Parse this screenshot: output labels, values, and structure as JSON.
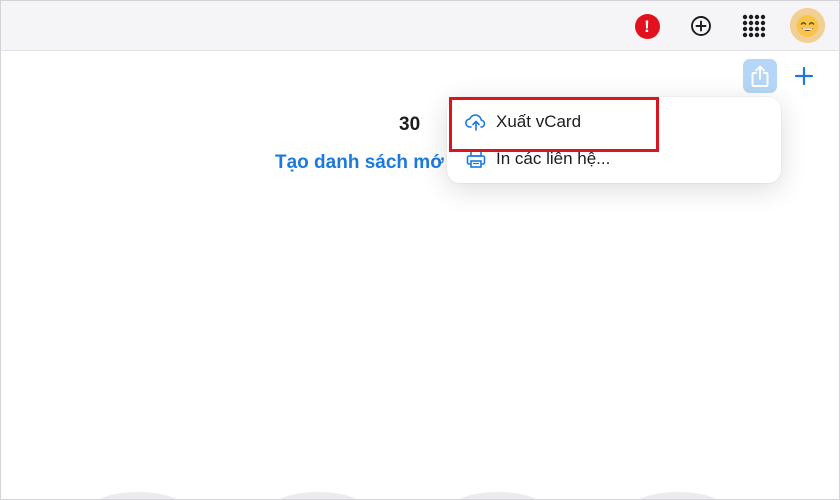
{
  "topbar": {
    "alert_symbol": "!",
    "icons": [
      "alert-icon",
      "add-circle-icon",
      "apps-grid-icon",
      "avatar-emoji"
    ]
  },
  "toolbar": {
    "icons": [
      "share-icon",
      "plus-icon"
    ]
  },
  "main": {
    "count": "30",
    "create_list_link": "Tạo danh sách mớ"
  },
  "dropdown": {
    "items": [
      {
        "icon": "cloud-upload-icon",
        "label": "Xuất vCard"
      },
      {
        "icon": "printer-icon",
        "label": "In các liên hệ..."
      }
    ]
  },
  "colors": {
    "accent": "#1a7ae0",
    "alert": "#e3101e",
    "highlight": "#d9161f",
    "share_button_bg": "#b5d6f6"
  }
}
